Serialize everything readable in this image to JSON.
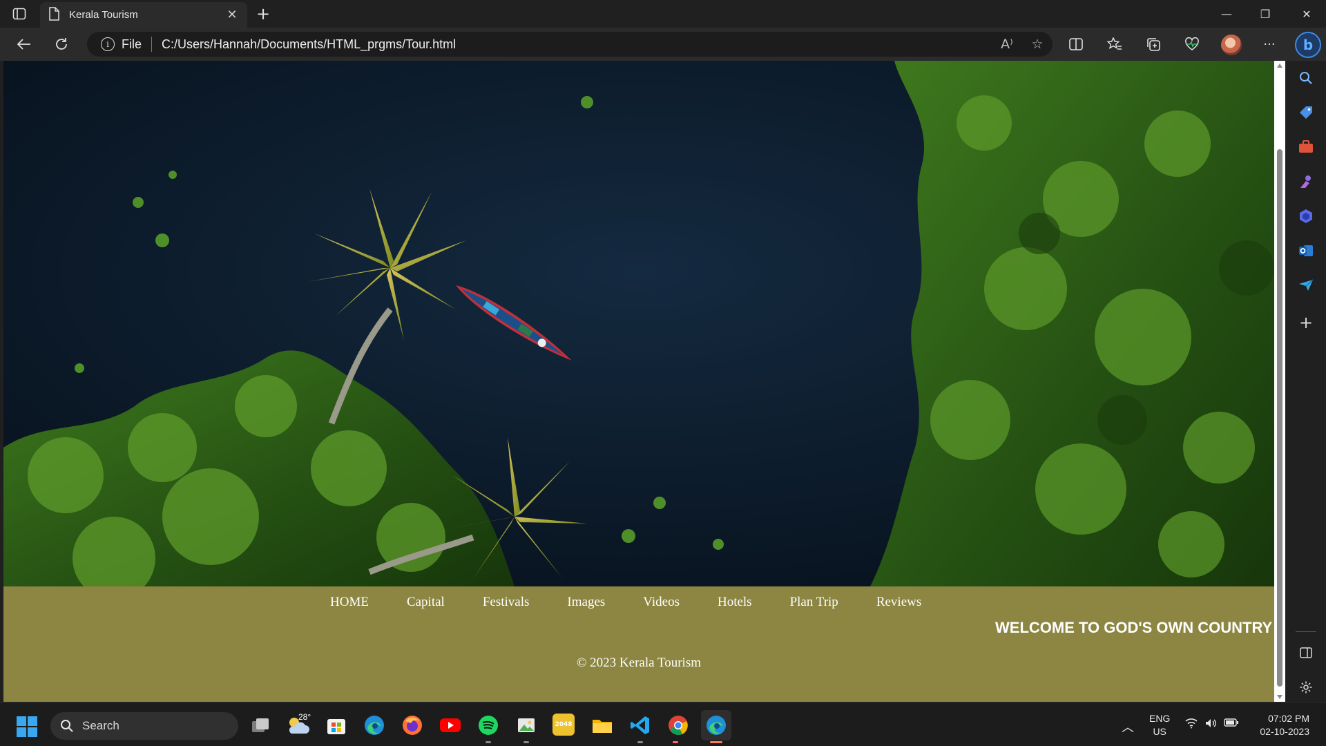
{
  "browser": {
    "tab_title": "Kerala Tourism",
    "tab_close": "✕",
    "new_tab": "+",
    "address_scheme_label": "File",
    "url": "C:/Users/Hannah/Documents/HTML_prgms/Tour.html",
    "window_controls": {
      "minimize": "—",
      "restore": "❐",
      "close": "✕"
    },
    "read_aloud": "A⁾",
    "more_menu": "···"
  },
  "page": {
    "nav": [
      "HOME",
      "Capital",
      "Festivals",
      "Images",
      "Videos",
      "Hotels",
      "Plan Trip",
      "Reviews"
    ],
    "marquee": "WELCOME TO GOD'S OWN COUNTRY",
    "footer": "© 2023 Kerala Tourism",
    "colors": {
      "nav_background": "#8c8642",
      "text": "#ffffff"
    }
  },
  "taskbar": {
    "search_placeholder": "Search",
    "weather_temp": "28°",
    "lang_line1": "ENG",
    "lang_line2": "US",
    "time": "07:02 PM",
    "date": "02-10-2023",
    "app_2048": "2048"
  }
}
